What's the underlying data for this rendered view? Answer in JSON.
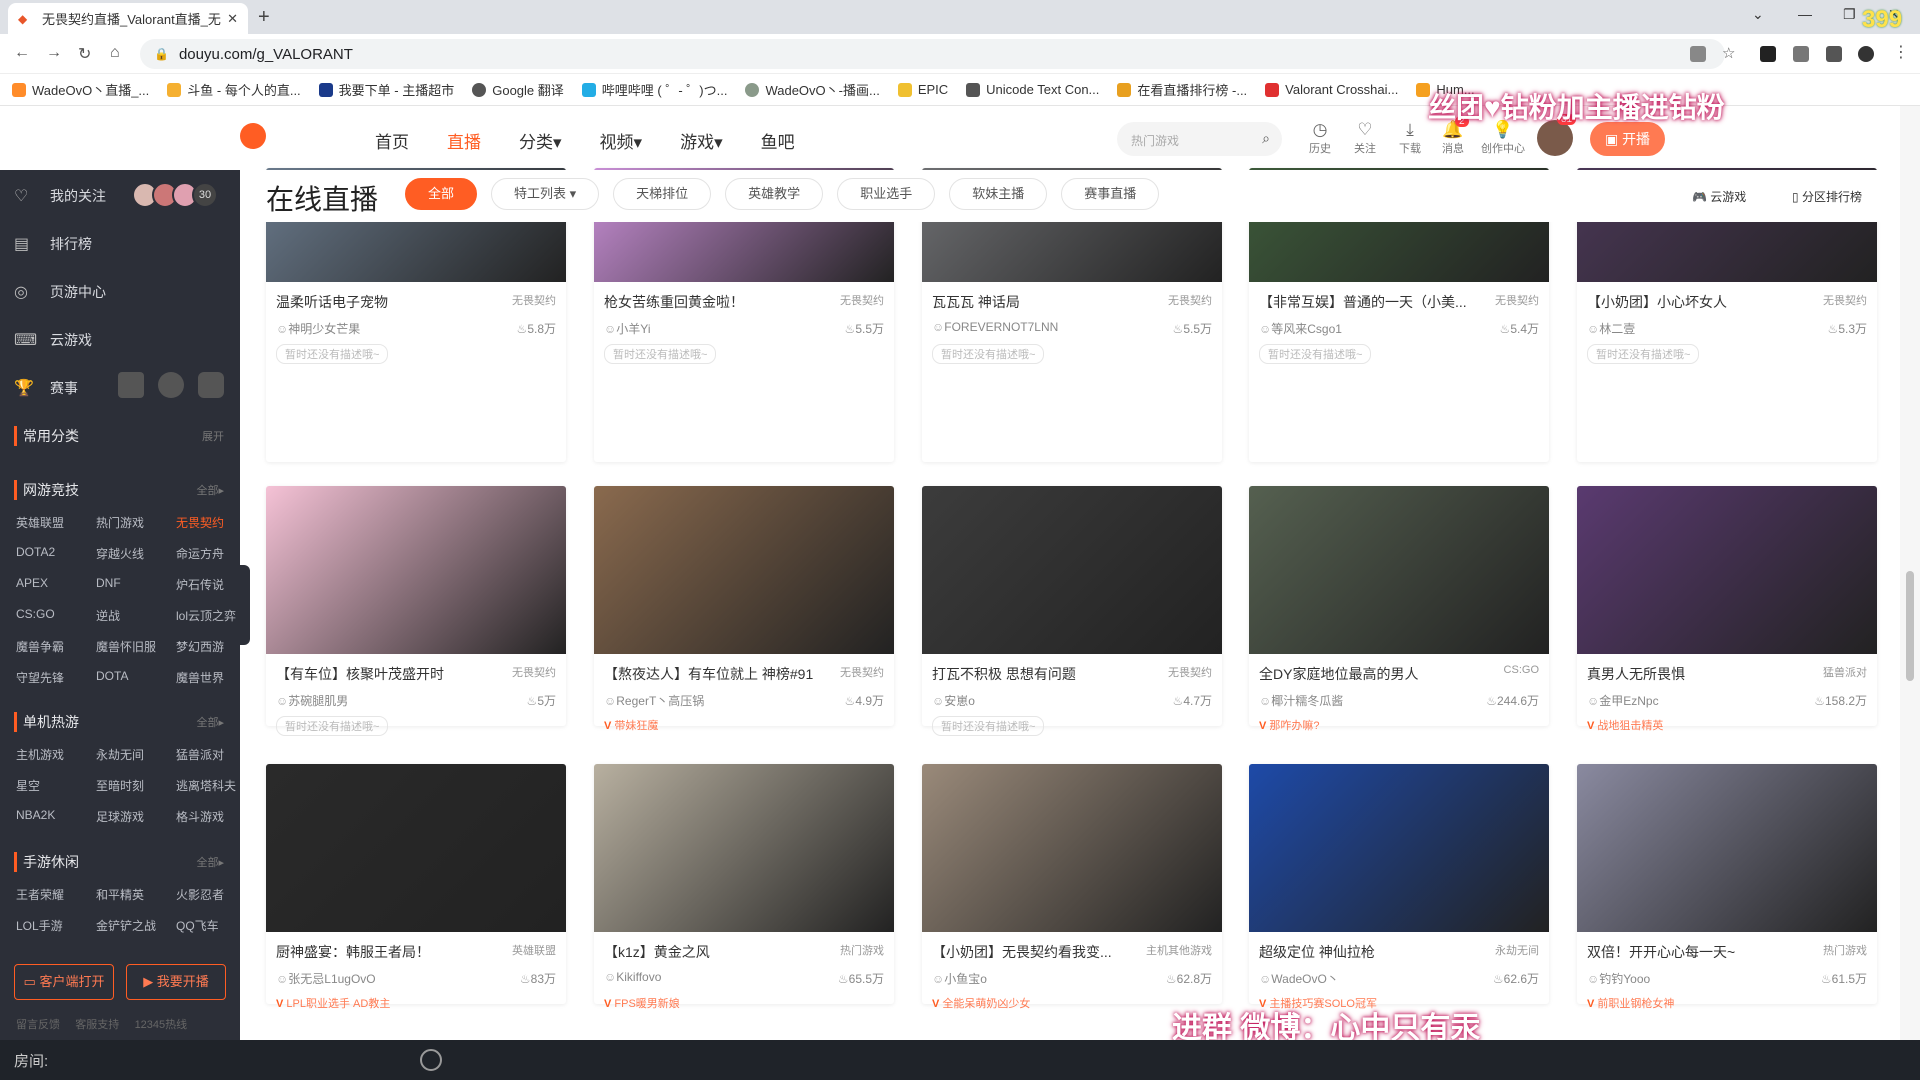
{
  "browser": {
    "tab_title": "无畏契约直播_Valorant直播_无畏",
    "url": "douyu.com/g_VALORANT",
    "bookmarks": [
      "WadeOvO丶直播_...",
      "斗鱼 - 每个人的直...",
      "我要下单 - 主播超市",
      "Google 翻译",
      "哔哩哔哩 ( ゜- ゜)つ...",
      "WadeOvO丶-播画...",
      "EPIC",
      "Unicode Text Con...",
      "在看直播排行榜 -...",
      "Valorant Crosshai...",
      "Hum..."
    ]
  },
  "header": {
    "nav": [
      "首页",
      "直播",
      "分类▾",
      "视频▾",
      "游戏▾",
      "鱼吧"
    ],
    "search_placeholder": "热门游戏",
    "icons": [
      {
        "label": "历史",
        "icon": "clock-icon"
      },
      {
        "label": "关注",
        "icon": "heart-icon"
      },
      {
        "label": "下载",
        "icon": "download-icon"
      },
      {
        "label": "消息",
        "icon": "bell-icon",
        "badge": "2"
      },
      {
        "label": "创作中心",
        "icon": "bulb-icon"
      }
    ],
    "avatar_badge": "81",
    "kaibo_label": "开播"
  },
  "overlay": {
    "top_text": "丝团♥钻粉加主播进钻粉",
    "corner_num": "399",
    "bottom_text": "进群 微博：心中只有汞"
  },
  "sidebar": {
    "follow_label": "我的关注",
    "follow_count": "30",
    "items": [
      "排行榜",
      "页游中心",
      "云游戏",
      "赛事"
    ],
    "common_label": "常用分类",
    "common_more": "展开",
    "sections": [
      {
        "title": "网游竞技",
        "more": "全部▸",
        "games": [
          "英雄联盟",
          "热门游戏",
          "无畏契约",
          "DOTA2",
          "穿越火线",
          "命运方舟",
          "APEX",
          "DNF",
          "炉石传说",
          "CS:GO",
          "逆战",
          "lol云顶之弈",
          "魔兽争霸",
          "魔兽怀旧服",
          "梦幻西游",
          "守望先锋",
          "DOTA",
          "魔兽世界"
        ],
        "active": "无畏契约"
      },
      {
        "title": "单机热游",
        "more": "全部▸",
        "games": [
          "主机游戏",
          "永劫无间",
          "猛兽派对",
          "星空",
          "至暗时刻",
          "逃离塔科夫",
          "NBA2K",
          "足球游戏",
          "格斗游戏"
        ]
      },
      {
        "title": "手游休闲",
        "more": "全部▸",
        "games": [
          "王者荣耀",
          "和平精英",
          "火影忍者",
          "LOL手游",
          "金铲铲之战",
          "QQ飞车"
        ]
      }
    ],
    "client_btn": "客户端打开",
    "kaibo_btn": "我要开播",
    "footer": [
      "留言反馈",
      "客服支持",
      "12345热线"
    ]
  },
  "main": {
    "title": "在线直播",
    "chips": [
      "全部",
      "特工列表 ▾",
      "天梯排位",
      "英雄教学",
      "职业选手",
      "软妹主播",
      "赛事直播"
    ],
    "right": [
      "云游戏",
      "分区排行榜"
    ],
    "cards": [
      {
        "title": "温柔听话电子宠物",
        "cat": "无畏契约",
        "streamer": "神明少女芒果",
        "views": "5.8万",
        "tag": "暂时还没有描述哦~",
        "hot": false,
        "color": "#6a7a8c"
      },
      {
        "title": "枪女苦练重回黄金啦！",
        "cat": "无畏契约",
        "streamer": "小羊Yi",
        "views": "5.5万",
        "tag": "暂时还没有描述哦~",
        "hot": false,
        "color": "#c98fd6"
      },
      {
        "title": "瓦瓦瓦 神话局",
        "cat": "无畏契约",
        "streamer": "FOREVERNOT7LNN",
        "views": "5.5万",
        "tag": "暂时还没有描述哦~",
        "hot": false,
        "color": "#6e6f72"
      },
      {
        "title": "【非常互娱】普通的一天（小美...",
        "cat": "无畏契约",
        "streamer": "等风来Csgo1",
        "views": "5.4万",
        "tag": "暂时还没有描述哦~",
        "hot": false,
        "color": "#3d5a3a"
      },
      {
        "title": "【小奶团】小心坏女人",
        "cat": "无畏契约",
        "streamer": "林二壹",
        "views": "5.3万",
        "tag": "暂时还没有描述哦~",
        "hot": false,
        "color": "#4a3756"
      },
      {
        "title": "【有车位】核聚叶茂盛开时",
        "cat": "无畏契约",
        "streamer": "苏碗腿肌男",
        "views": "5万",
        "tag": "暂时还没有描述哦~",
        "hot": false,
        "color": "#f5c2d6"
      },
      {
        "title": "【熬夜达人】有车位就上 神榜#91",
        "cat": "无畏契约",
        "streamer": "RegerT丶高压锅",
        "views": "4.9万",
        "tag": "带妹狂魔",
        "hot": true,
        "color": "#8a6a4e"
      },
      {
        "title": "打瓦不积极 思想有问题",
        "cat": "无畏契约",
        "streamer": "安崽o",
        "views": "4.7万",
        "tag": "暂时还没有描述哦~",
        "hot": false,
        "color": "#3c3c3c"
      },
      {
        "title": "全DY家庭地位最高的男人",
        "cat": "CS:GO",
        "streamer": "椰汁糯冬瓜酱",
        "views": "244.6万",
        "tag": "那咋办嘛?",
        "hot": true,
        "color": "#556050"
      },
      {
        "title": "真男人无所畏惧",
        "cat": "猛兽派对",
        "streamer": "金甲EzNpc",
        "views": "158.2万",
        "tag": "战地狙击精英",
        "hot": true,
        "color": "#5a3a70"
      },
      {
        "title": "厨神盛宴：韩服王者局！",
        "cat": "英雄联盟",
        "streamer": "张无忌L1ugOvO",
        "views": "83万",
        "tag": "LPL职业选手 AD教主",
        "hot": true,
        "color": "#2a2a2a"
      },
      {
        "title": "【k1z】黄金之风",
        "cat": "热门游戏",
        "streamer": "Kikiffovo",
        "views": "65.5万",
        "tag": "FPS暖男新娘",
        "hot": true,
        "color": "#b8b0a0"
      },
      {
        "title": "【小奶团】无畏契约看我变...",
        "cat": "主机其他游戏",
        "streamer": "小鱼宝o",
        "views": "62.8万",
        "tag": "全能呆萌奶凶少女",
        "hot": true,
        "color": "#9a8a7a"
      },
      {
        "title": "超级定位 神仙拉枪",
        "cat": "永劫无间",
        "streamer": "WadeOvO丶",
        "views": "62.6万",
        "tag": "主播技巧赛SOLO冠军",
        "hot": true,
        "color": "#1e4aa8"
      },
      {
        "title": "双倍！开开心心每一天~",
        "cat": "热门游戏",
        "streamer": "钓钓Yooo",
        "views": "61.5万",
        "tag": "前职业钢枪女神",
        "hot": true,
        "color": "#8a8aa0"
      }
    ]
  },
  "roombar": {
    "label": "房间:"
  }
}
